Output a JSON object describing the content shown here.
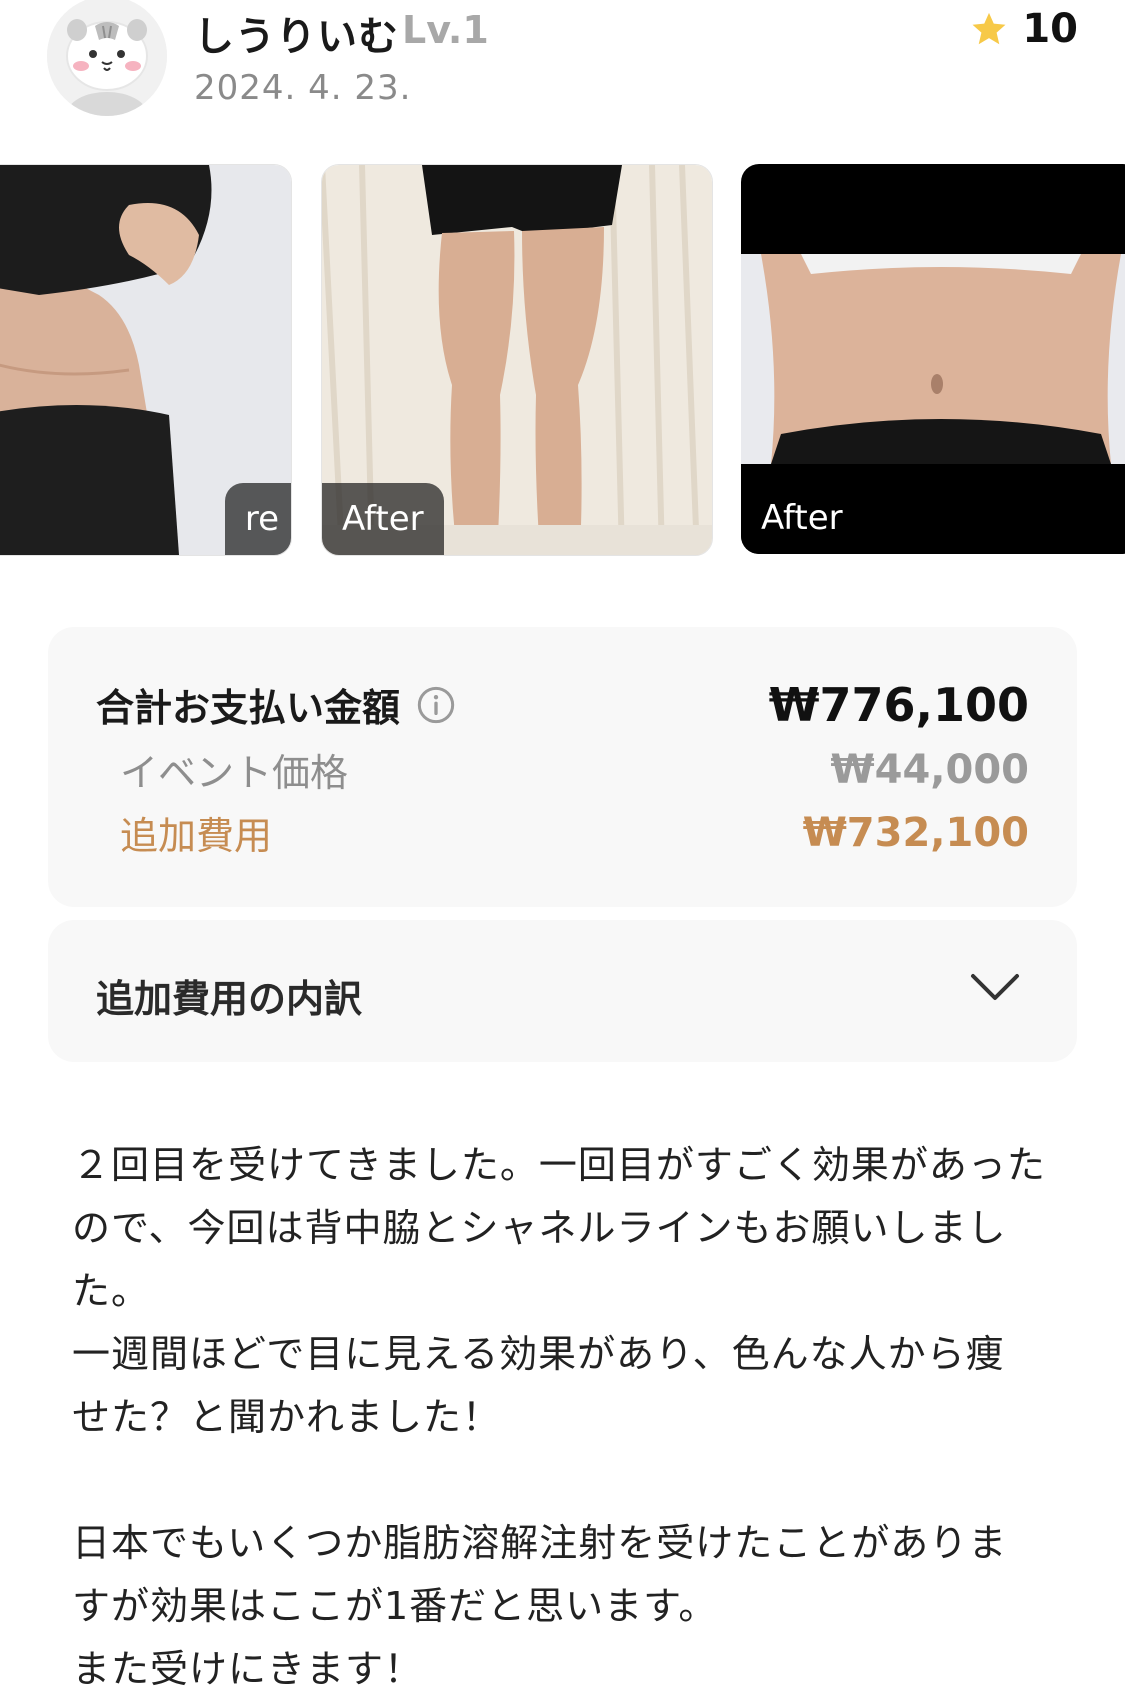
{
  "header": {
    "username": "しうりいむ",
    "level": "Lv.1",
    "date": "2024. 4. 23.",
    "rating": "10",
    "star_color": "#F7C948"
  },
  "photos": [
    {
      "tag": "re"
    },
    {
      "tag": "After"
    },
    {
      "tag": "After"
    }
  ],
  "payment": {
    "total_label": "合計お支払い金額",
    "total_value": "₩776,100",
    "event_label": "イベント価格",
    "event_value": "₩44,000",
    "extra_label": "追加費用",
    "extra_value": "₩732,100",
    "accent_color": "#C68C52"
  },
  "breakdown": {
    "label": "追加費用の内訳"
  },
  "review": {
    "paragraph1_line1": "２回目を受けてきました。一回目がすごく効果があった",
    "paragraph1_line2": "ので、今回は背中脇とシャネルラインもお願いしまし",
    "paragraph1_line3": "た。",
    "paragraph1_line4": "一週間ほどで目に見える効果があり、色んな人から痩",
    "paragraph1_line5": "せた？と聞かれました！",
    "paragraph2_line1": "日本でもいくつか脂肪溶解注射を受けたことがありま",
    "paragraph2_line2": "すが効果はここが1番だと思います。",
    "paragraph2_line3": "また受けにきます！"
  }
}
